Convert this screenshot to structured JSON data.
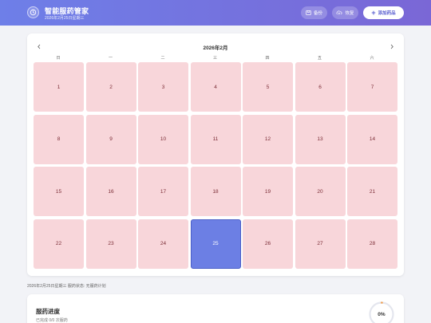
{
  "header": {
    "title": "智能服药管家",
    "date": "2026年2月25日星期三",
    "backup_label": "备份",
    "restore_label": "恢复",
    "add_label": "添加药品"
  },
  "calendar": {
    "month_title": "2026年2月",
    "weekdays": [
      "日",
      "一",
      "二",
      "三",
      "四",
      "五",
      "六"
    ],
    "today": 25,
    "weeks": [
      [
        "1",
        "2",
        "3",
        "4",
        "5",
        "6",
        "7"
      ],
      [
        "8",
        "9",
        "10",
        "11",
        "12",
        "13",
        "14"
      ],
      [
        "15",
        "16",
        "17",
        "18",
        "19",
        "20",
        "21"
      ],
      [
        "22",
        "23",
        "24",
        "25",
        "26",
        "27",
        "28"
      ]
    ]
  },
  "status_line": "2026年2月25日星期三  服药状态: 无服药计划",
  "progress": {
    "title": "服药进度",
    "subtitle": "已完成 0/0 次服药",
    "percent_label": "0%",
    "percent": 0
  },
  "colors": {
    "header_start": "#6e7fe8",
    "header_end": "#7a67d6",
    "day_bg": "#f8d6da",
    "today_bg": "#6c7fe4"
  }
}
